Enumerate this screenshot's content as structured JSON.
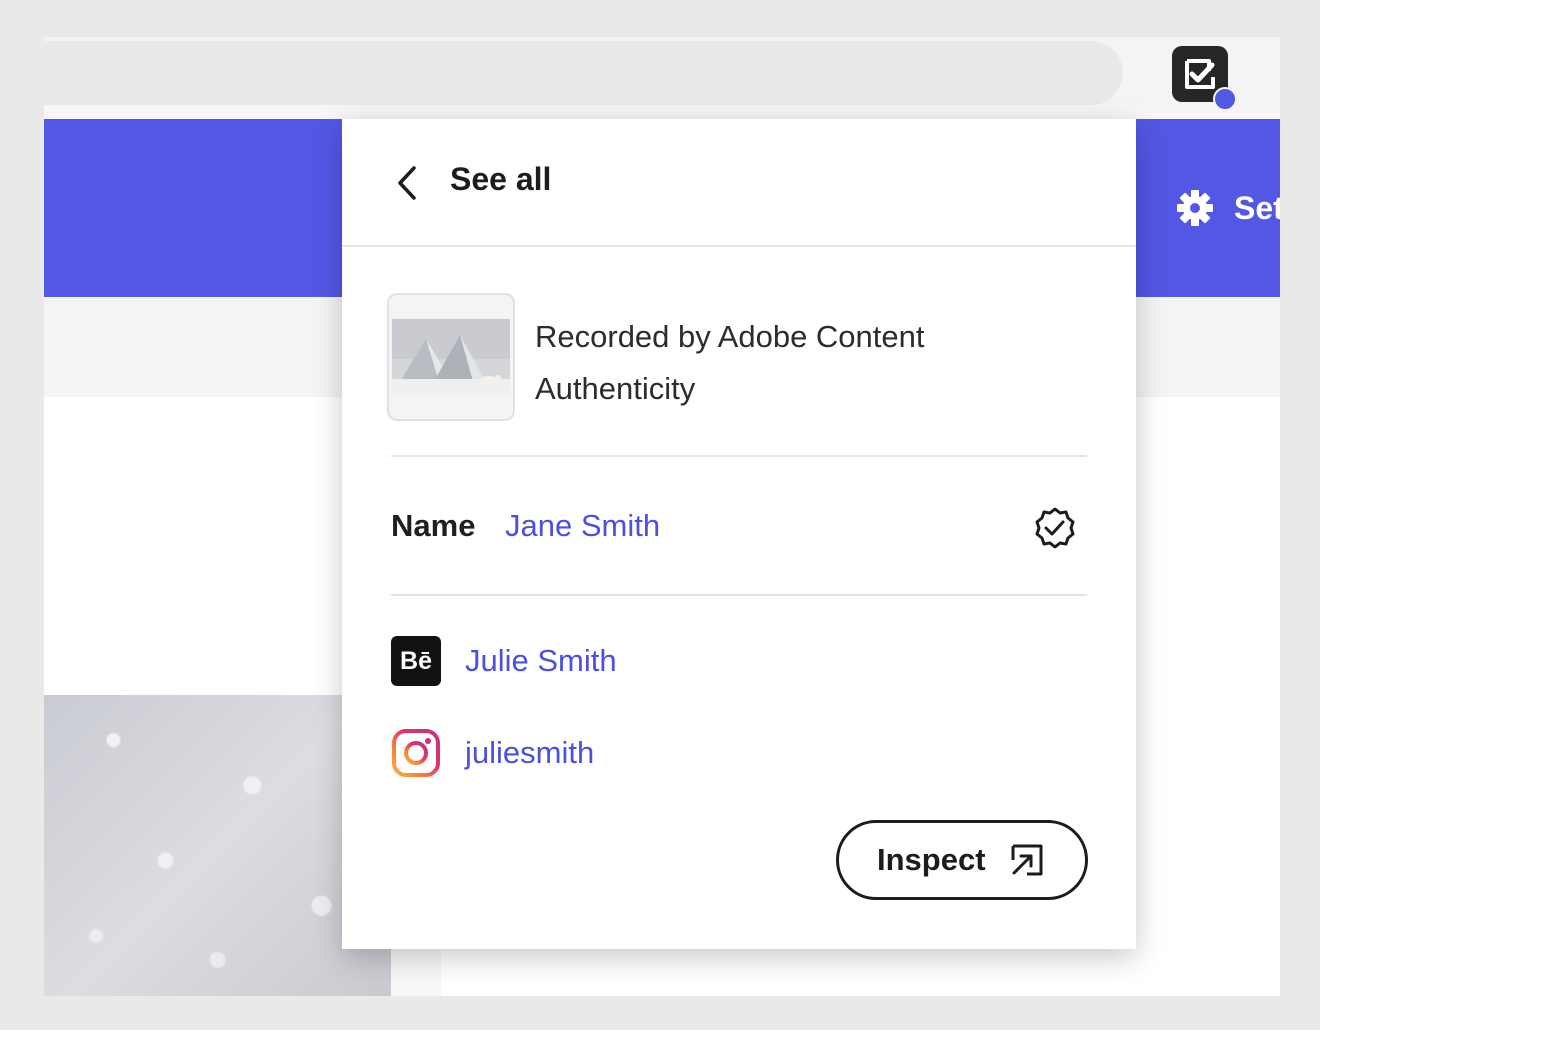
{
  "popup": {
    "back_label": "See all",
    "recorded_by": "Recorded by Adobe Content Authenticity",
    "name_label": "Name",
    "name_value": "Jane Smith",
    "accounts": [
      {
        "service": "Behance",
        "icon": "behance-icon",
        "icon_text": "Bē",
        "handle": "Julie Smith"
      },
      {
        "service": "Instagram",
        "icon": "instagram-icon",
        "handle": "juliesmith"
      }
    ],
    "inspect_label": "Inspect"
  },
  "header": {
    "settings_label": "Set"
  },
  "colors": {
    "accent": "#5258e4",
    "link": "#4b50e0",
    "extension_tile": "#262626"
  }
}
